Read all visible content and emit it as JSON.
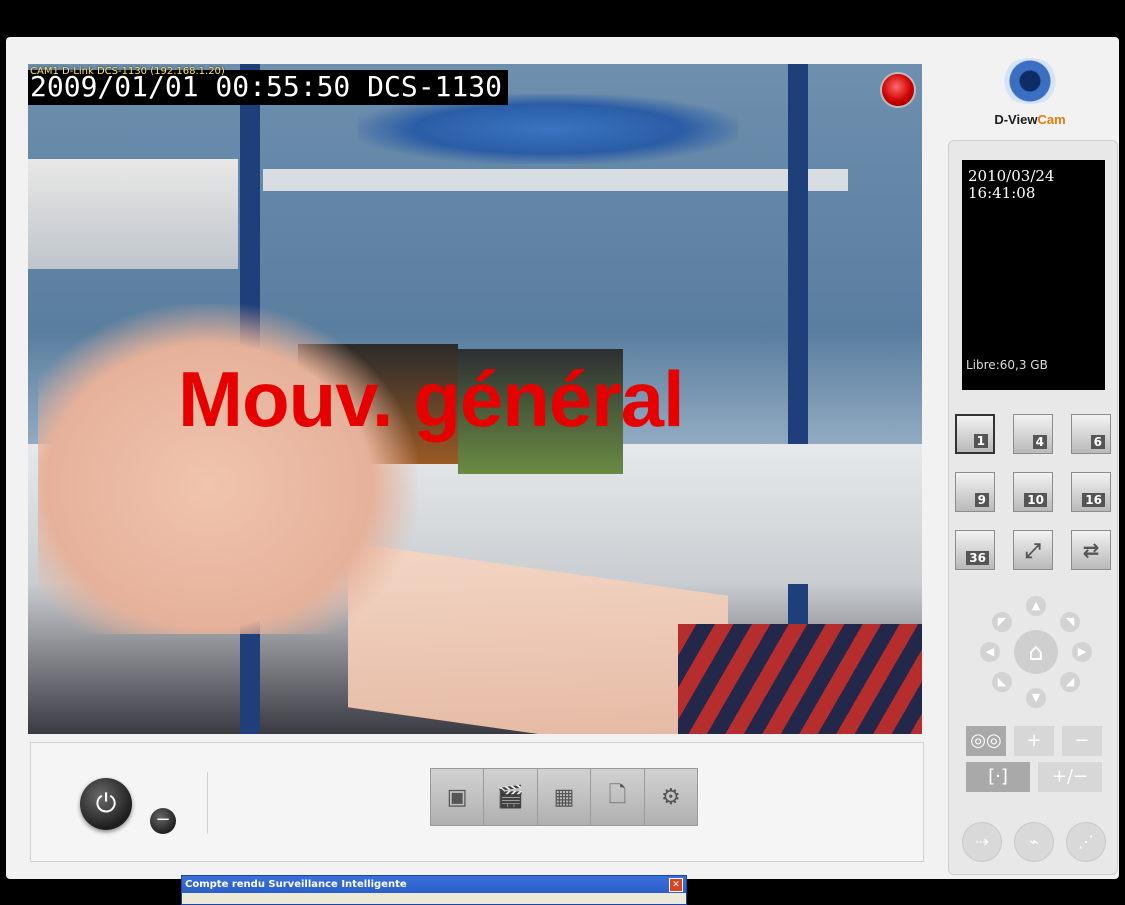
{
  "video": {
    "overlay_small": "CAM1 D-Link DCS-1130 (192.168.1.20)",
    "overlay_big": "2009/01/01 00:55:50 DCS-1130",
    "motion_text": "Mouv. général"
  },
  "logo": {
    "text_a": "D-View",
    "text_b": "Cam"
  },
  "clock": {
    "date": "2010/03/24",
    "time": "16:41:08",
    "free_space": "Libre:60,3 GB"
  },
  "layout_buttons": [
    "1",
    "4",
    "6",
    "9",
    "10",
    "16",
    "36"
  ],
  "toolbar": {
    "icons": [
      "playback-icon",
      "clapper-icon",
      "schedule-icon",
      "document-icon",
      "gear-icon"
    ]
  },
  "ptz": {
    "zoom_plus": "+",
    "zoom_minus": "−",
    "fine_toggle": "+/−"
  },
  "dialog": {
    "title": "Compte rendu Surveillance Intelligente"
  }
}
